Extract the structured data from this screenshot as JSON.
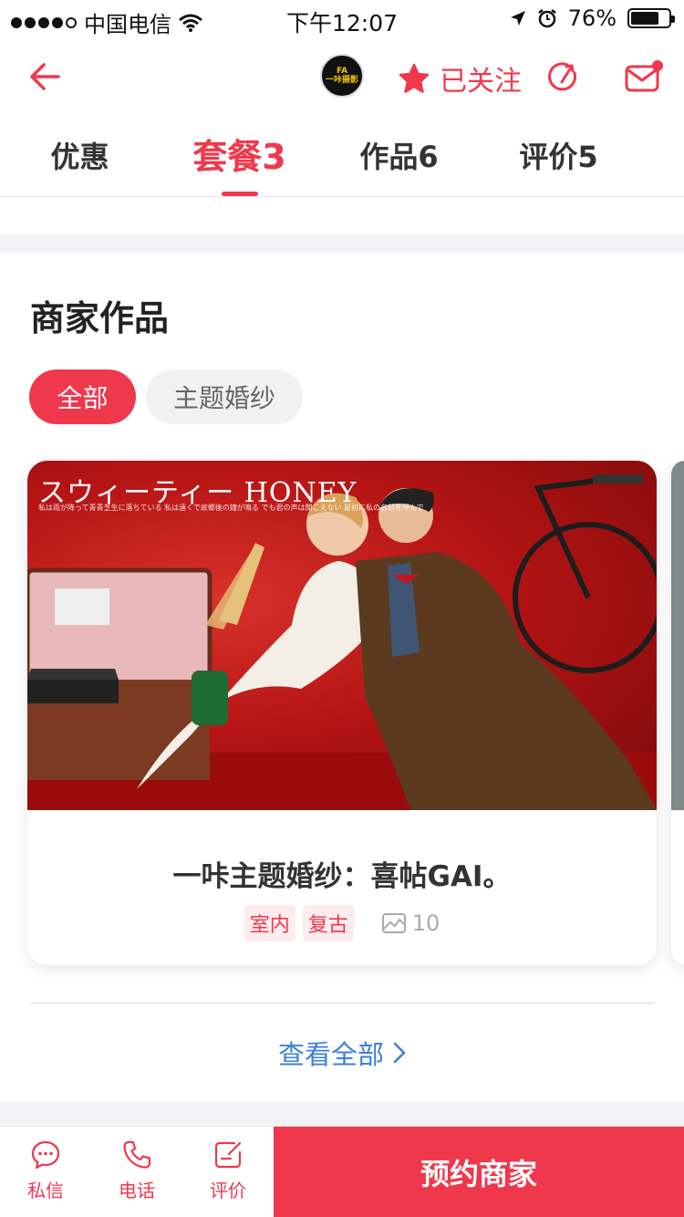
{
  "status_bar": {
    "carrier": "中国电信",
    "time": "下午12:07",
    "battery": "76%",
    "battery_level": 0.76
  },
  "nav": {
    "avatar_text_1": "FA",
    "avatar_text_2": "一咔摄影",
    "follow_label": "已关注"
  },
  "tabs": [
    {
      "label": "优惠"
    },
    {
      "label": "套餐3"
    },
    {
      "label": "作品6"
    },
    {
      "label": "评价5"
    }
  ],
  "section": {
    "title": "商家作品",
    "filters": [
      {
        "label": "全部"
      },
      {
        "label": "主题婚纱"
      }
    ]
  },
  "card": {
    "photo_title": "スウィーティー HONEY",
    "photo_sub_top": "私は雨が降って青青芝生に落ちている 私は遠くで故郷後の鐘が鳴る でも君の声は聞こえない 最初に私の名前を呼んで",
    "photo_sub": "私は雨が降って青青芝生に落ちている\n私は遠くで故郷後の鐘が鳴る\nでも君の声は聞こえない\n真剣に私の名前を呼んで",
    "name": "一咔主题婚纱：喜帖GAI。",
    "tags": [
      "室内",
      "复古"
    ],
    "photo_count": "10"
  },
  "view_all": "查看全部",
  "bottom_bar": {
    "items": [
      {
        "label": "私信"
      },
      {
        "label": "电话"
      },
      {
        "label": "评价"
      }
    ],
    "book_label": "预约商家"
  },
  "colors": {
    "accent": "#f0384c",
    "link": "#3d7fd8"
  }
}
